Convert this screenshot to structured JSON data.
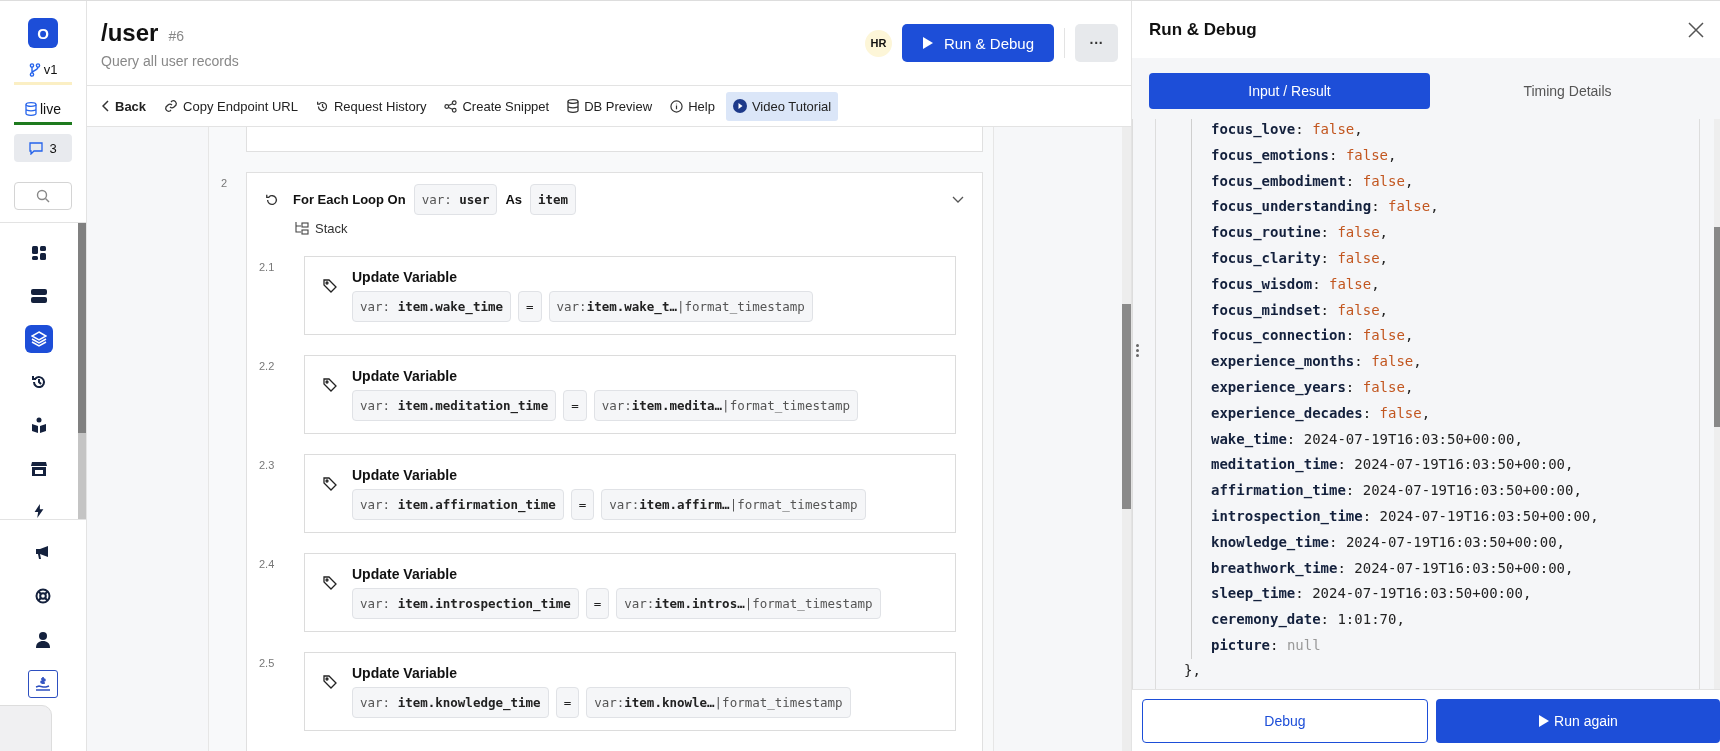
{
  "sidebar": {
    "logo": "O",
    "branch": "v1",
    "environment": "live",
    "comments": "3",
    "nav_items": [
      {
        "kind": "dashboard",
        "selected": false
      },
      {
        "kind": "database",
        "selected": false
      },
      {
        "kind": "layers",
        "selected": true
      },
      {
        "kind": "history",
        "selected": false
      },
      {
        "kind": "library",
        "selected": false
      },
      {
        "kind": "store",
        "selected": false
      },
      {
        "kind": "bolt",
        "selected": false
      }
    ],
    "bottom_items": [
      {
        "kind": "megaphone",
        "selected": false
      },
      {
        "kind": "lifebuoy",
        "selected": false
      },
      {
        "kind": "user",
        "selected": false
      },
      {
        "kind": "payout",
        "selected": true
      }
    ]
  },
  "header": {
    "title": "/user",
    "number": "#6",
    "subtitle": "Query all user records",
    "avatar": "HR",
    "run_button": "Run & Debug",
    "more_button": "···"
  },
  "toolbar": [
    {
      "kind": "back",
      "label": "Back",
      "selected": false
    },
    {
      "kind": "link",
      "label": "Copy Endpoint URL",
      "selected": false
    },
    {
      "kind": "history",
      "label": "Request History",
      "selected": false
    },
    {
      "kind": "share",
      "label": "Create Snippet",
      "selected": false
    },
    {
      "kind": "database",
      "label": "DB Preview",
      "selected": false
    },
    {
      "kind": "info",
      "label": "Help",
      "selected": false
    },
    {
      "kind": "play",
      "label": "Video Tutorial",
      "selected": true
    }
  ],
  "loop": {
    "number": "2",
    "label": "For Each Loop On",
    "source_prefix": "var:",
    "source": "user",
    "as_label": "As",
    "alias": "item",
    "stack_label": "Stack",
    "expanded": true,
    "steps": [
      {
        "number": "2.1",
        "title": "Update Variable",
        "target_prefix": "var:",
        "target": "item.wake_time",
        "operator": "=",
        "value_prefix": "var:",
        "value": "item.wake_t…",
        "filter": "|format_timestamp"
      },
      {
        "number": "2.2",
        "title": "Update Variable",
        "target_prefix": "var:",
        "target": "item.meditation_time",
        "operator": "=",
        "value_prefix": "var:",
        "value": "item.medita…",
        "filter": "|format_timestamp"
      },
      {
        "number": "2.3",
        "title": "Update Variable",
        "target_prefix": "var:",
        "target": "item.affirmation_time",
        "operator": "=",
        "value_prefix": "var:",
        "value": "item.affirm…",
        "filter": "|format_timestamp"
      },
      {
        "number": "2.4",
        "title": "Update Variable",
        "target_prefix": "var:",
        "target": "item.introspection_time",
        "operator": "=",
        "value_prefix": "var:",
        "value": "item.intros…",
        "filter": "|format_timestamp"
      },
      {
        "number": "2.5",
        "title": "Update Variable",
        "target_prefix": "var:",
        "target": "item.knowledge_time",
        "operator": "=",
        "value_prefix": "var:",
        "value": "item.knowle…",
        "filter": "|format_timestamp"
      }
    ]
  },
  "debug_panel": {
    "title": "Run & Debug",
    "tabs": [
      {
        "label": "Input / Result",
        "selected": true
      },
      {
        "label": "Timing Details",
        "selected": false
      }
    ],
    "result_lines": [
      {
        "key": "focus_love",
        "separator": ":",
        "value": "false",
        "kind": "boolean",
        "trailing": ","
      },
      {
        "key": "focus_emotions",
        "separator": ":",
        "value": "false",
        "kind": "boolean",
        "trailing": ","
      },
      {
        "key": "focus_embodiment",
        "separator": ":",
        "value": "false",
        "kind": "boolean",
        "trailing": ","
      },
      {
        "key": "focus_understanding",
        "separator": ":",
        "value": "false",
        "kind": "boolean",
        "trailing": ","
      },
      {
        "key": "focus_routine",
        "separator": ":",
        "value": "false",
        "kind": "boolean",
        "trailing": ","
      },
      {
        "key": "focus_clarity",
        "separator": ":",
        "value": "false",
        "kind": "boolean",
        "trailing": ","
      },
      {
        "key": "focus_wisdom",
        "separator": ":",
        "value": "false",
        "kind": "boolean",
        "trailing": ","
      },
      {
        "key": "focus_mindset",
        "separator": ":",
        "value": "false",
        "kind": "boolean",
        "trailing": ","
      },
      {
        "key": "focus_connection",
        "separator": ":",
        "value": "false",
        "kind": "boolean",
        "trailing": ","
      },
      {
        "key": "experience_months",
        "separator": ":",
        "value": "false",
        "kind": "boolean",
        "trailing": ","
      },
      {
        "key": "experience_years",
        "separator": ":",
        "value": "false",
        "kind": "boolean",
        "trailing": ","
      },
      {
        "key": "experience_decades",
        "separator": ":",
        "value": "false",
        "kind": "boolean",
        "trailing": ","
      },
      {
        "key": "wake_time",
        "separator": ":",
        "value": "2024-07-19T16:03:50+00:00",
        "kind": "string",
        "trailing": ","
      },
      {
        "key": "meditation_time",
        "separator": ":",
        "value": "2024-07-19T16:03:50+00:00",
        "kind": "string",
        "trailing": ","
      },
      {
        "key": "affirmation_time",
        "separator": ":",
        "value": "2024-07-19T16:03:50+00:00",
        "kind": "string",
        "trailing": ","
      },
      {
        "key": "introspection_time",
        "separator": ":",
        "value": "2024-07-19T16:03:50+00:00",
        "kind": "string",
        "trailing": ","
      },
      {
        "key": "knowledge_time",
        "separator": ":",
        "value": "2024-07-19T16:03:50+00:00",
        "kind": "string",
        "trailing": ","
      },
      {
        "key": "breathwork_time",
        "separator": ":",
        "value": "2024-07-19T16:03:50+00:00",
        "kind": "string",
        "trailing": ","
      },
      {
        "key": "sleep_time",
        "separator": ":",
        "value": "2024-07-19T16:03:50+00:00",
        "kind": "string",
        "trailing": ","
      },
      {
        "key": "ceremony_date",
        "separator": ":",
        "value": "1:01:70",
        "kind": "string",
        "trailing": ","
      },
      {
        "key": "picture",
        "separator": ":",
        "value": "null",
        "kind": "null"
      }
    ],
    "closing": "},",
    "debug_button": "Debug",
    "run_again_button": "Run again"
  }
}
